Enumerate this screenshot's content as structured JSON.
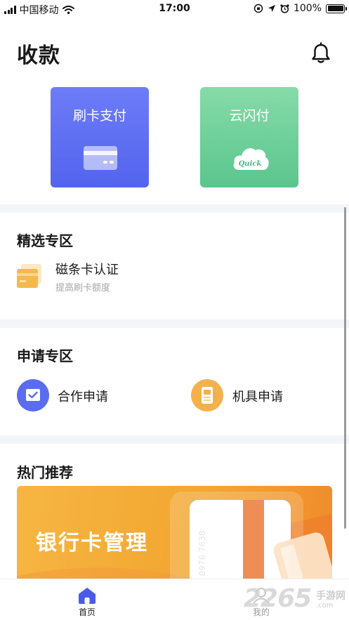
{
  "status_bar": {
    "carrier": "中国移动",
    "time": "17:00",
    "battery": "100%"
  },
  "header": {
    "title": "收款"
  },
  "tiles": [
    {
      "label": "刷卡支付",
      "icon": "bank-card-icon",
      "color": "#5c6cf2"
    },
    {
      "label": "云闪付",
      "icon": "quick-cloud-icon",
      "color": "#6ccf99",
      "icon_text": "Quick"
    }
  ],
  "featured": {
    "title": "精选专区",
    "item": {
      "name": "磁条卡认证",
      "subtitle": "提高刷卡额度",
      "icon": "card-stack-icon"
    }
  },
  "apply": {
    "title": "申请专区",
    "items": [
      {
        "label": "合作申请",
        "icon": "check-doc-icon",
        "color": "#5a6df0"
      },
      {
        "label": "机具申请",
        "icon": "pos-device-icon",
        "color": "#f3b14c"
      }
    ]
  },
  "hot": {
    "title": "热门推荐",
    "banner_text": "银行卡管理",
    "card_number": "5 0976 7638"
  },
  "tabbar": {
    "items": [
      {
        "label": "首页",
        "icon": "home-icon",
        "active": true,
        "color": "#4a5bea"
      },
      {
        "label": "我的",
        "icon": "user-icon",
        "active": false
      }
    ]
  },
  "watermark": {
    "number": "2265",
    "cn": "手游网",
    "url": ".com"
  }
}
